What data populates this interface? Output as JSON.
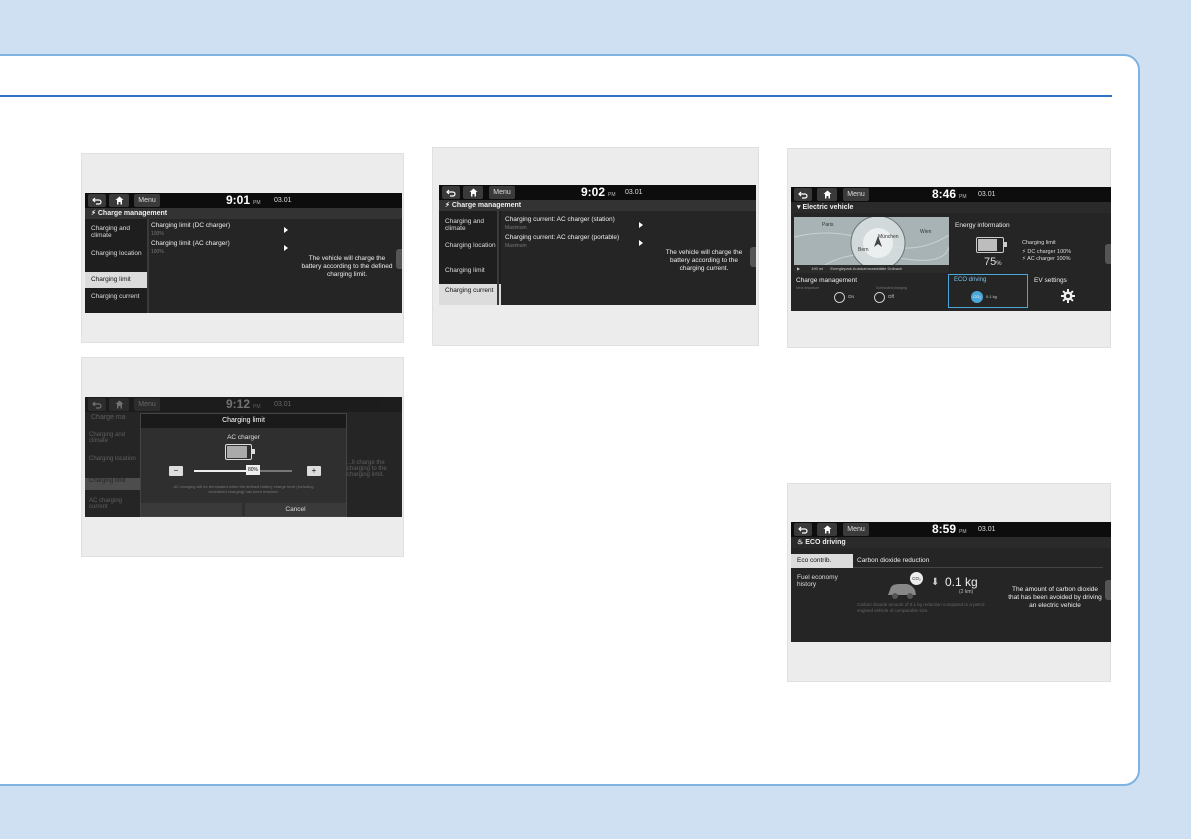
{
  "s1": {
    "back": "back-icon",
    "home": "home-icon",
    "menu": "Menu",
    "time": "9:01",
    "ampm": "PM",
    "date": "03.01",
    "title": "Charge management",
    "sidebar": [
      "Charging and climate",
      "Charging location",
      "Charging limit",
      "Charging current"
    ],
    "rows": [
      {
        "label": "Charging limit (DC charger)",
        "sub": "100%"
      },
      {
        "label": "Charging limit (AC charger)",
        "sub": "100%"
      }
    ],
    "desc": "The vehicle will charge the battery according to the defined charging limit."
  },
  "s2": {
    "menu": "Menu",
    "time": "9:02",
    "ampm": "PM",
    "date": "03.01",
    "title": "Charge management",
    "sidebar": [
      "Charging and climate",
      "Charging location",
      "Charging limit",
      "Charging current"
    ],
    "rows": [
      {
        "label": "Charging current: AC charger (station)",
        "sub": "Maximum"
      },
      {
        "label": "Charging current: AC charger (portable)",
        "sub": "Maximum"
      }
    ],
    "desc": "The vehicle will charge the battery according to the charging current."
  },
  "s3": {
    "menu": "Menu",
    "time": "8:46",
    "ampm": "PM",
    "date": "03.01",
    "title": "Electric vehicle",
    "energy_title": "Energy information",
    "battery_pct": "75",
    "pct_sign": "%",
    "charging_limit": "Charging limit",
    "dc_limit": "DC charger 100%",
    "ac_limit": "AC charger 100%",
    "map_labels": [
      "Paris",
      "München",
      "Wien",
      "Bern"
    ],
    "map_range": "190 mi",
    "map_station": "Energiepark Autobahnraststätte Dolbach",
    "charge_mgmt": "Charge management",
    "cm_sub_left": "Next departure",
    "cm_sub_right": "Scheduled charging",
    "cm_val_left": "On",
    "cm_val_right": "Off",
    "eco": "ECO driving",
    "eco_badge": "CO₂",
    "eco_val": "0.1 kg",
    "ev_settings": "EV settings"
  },
  "s4": {
    "menu": "Menu",
    "time": "9:12",
    "ampm": "PM",
    "date": "03.01",
    "bg_title": "Charge ma",
    "bg_side": [
      "Charging and climate",
      "Charging location",
      "Charging limit",
      "AC charging current"
    ],
    "bg_desc": "...ll charge the charging to the charging limit.",
    "popup_title": "Charging limit",
    "popup_sub": "AC charger",
    "minus": "−",
    "plus": "+",
    "pct": "80%",
    "note": "AC charging will be terminated when the defined battery charge level (including scheduled charging) has been reached.",
    "ok": "",
    "cancel": "Cancel"
  },
  "s5": {
    "menu": "Menu",
    "time": "8:59",
    "ampm": "PM",
    "date": "03.01",
    "title": "ECO driving",
    "sidebar": [
      "Eco contrib.",
      "Fuel economy history"
    ],
    "header": "Carbon dioxide reduction",
    "co2_badge": "CO₂",
    "value": "0.1 kg",
    "distance": "(2 km)",
    "small": "Carbon dioxide amount of 0.1 kg reduction compared to a petrol-engined vehicle of comparable size.",
    "desc": "The amount of carbon dioxide that has been avoided by driving an electric vehicle"
  }
}
